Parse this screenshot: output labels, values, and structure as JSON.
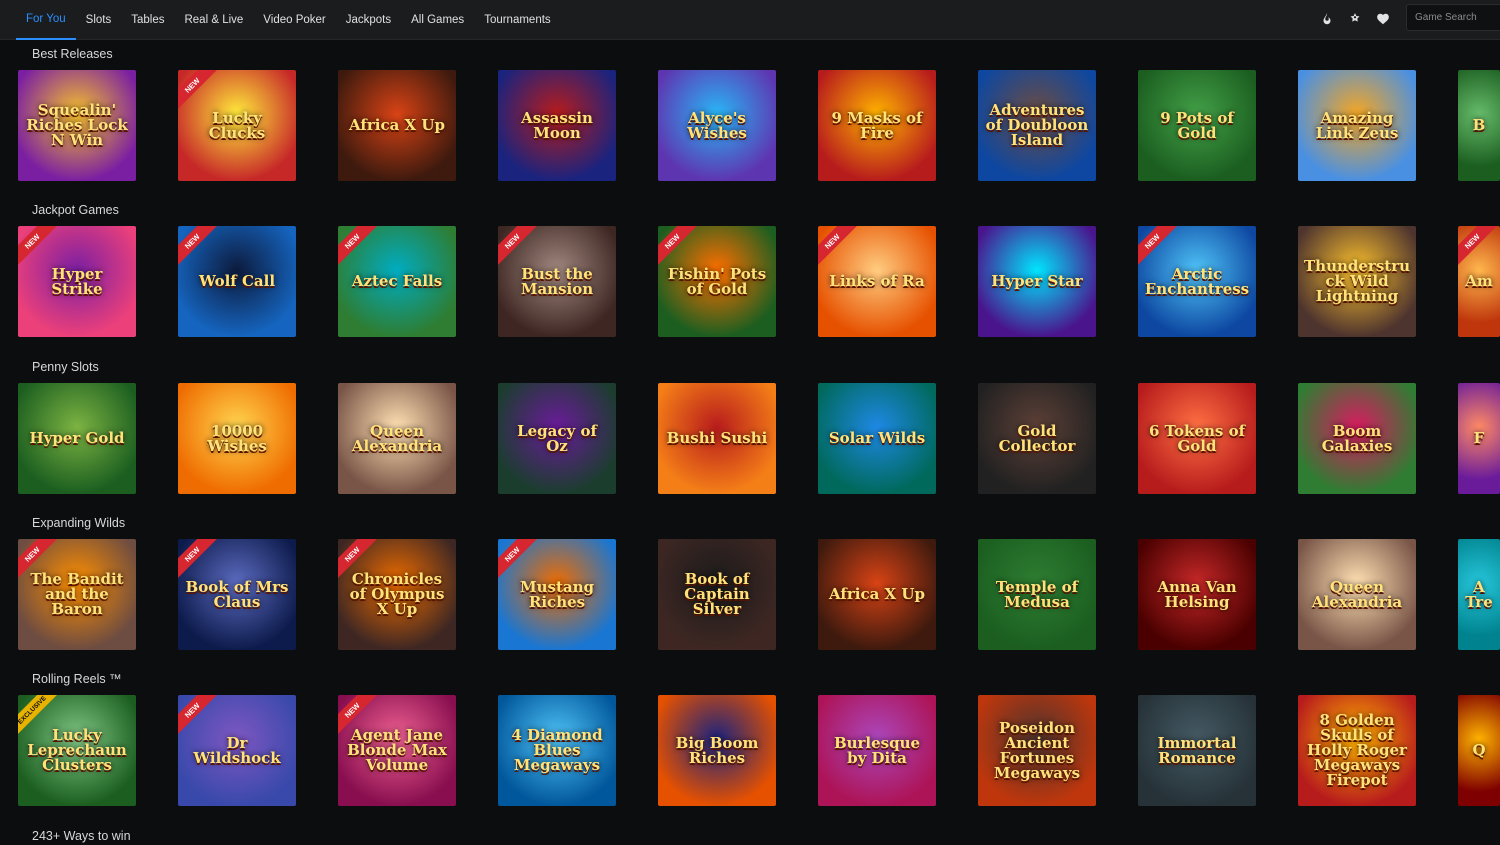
{
  "nav": {
    "items": [
      "For You",
      "Slots",
      "Tables",
      "Real & Live",
      "Video Poker",
      "Jackpots",
      "All Games",
      "Tournaments"
    ],
    "active_index": 0
  },
  "header_icons": [
    "flame-icon",
    "star-gear-icon",
    "heart-icon"
  ],
  "search": {
    "placeholder": "Game Search"
  },
  "sections": [
    {
      "title": "Best Releases",
      "games": [
        {
          "name": "Squealin' Riches Lock N Win",
          "badge": ""
        },
        {
          "name": "Lucky Clucks",
          "badge": "NEW"
        },
        {
          "name": "Africa X Up",
          "badge": ""
        },
        {
          "name": "Assassin Moon",
          "badge": ""
        },
        {
          "name": "Alyce's Wishes",
          "badge": ""
        },
        {
          "name": "9 Masks of Fire",
          "badge": ""
        },
        {
          "name": "Adventures of Doubloon Island",
          "badge": ""
        },
        {
          "name": "9 Pots of Gold",
          "badge": ""
        },
        {
          "name": "Amazing Link Zeus",
          "badge": ""
        },
        {
          "name": "B",
          "badge": ""
        }
      ]
    },
    {
      "title": "Jackpot Games",
      "games": [
        {
          "name": "Hyper Strike",
          "badge": "NEW"
        },
        {
          "name": "Wolf Call",
          "badge": "NEW"
        },
        {
          "name": "Aztec Falls",
          "badge": "NEW"
        },
        {
          "name": "Bust the Mansion",
          "badge": "NEW"
        },
        {
          "name": "Fishin' Pots of Gold",
          "badge": "NEW"
        },
        {
          "name": "Links of Ra",
          "badge": "NEW"
        },
        {
          "name": "Hyper Star",
          "badge": ""
        },
        {
          "name": "Arctic Enchantress",
          "badge": "NEW"
        },
        {
          "name": "Thunderstruck Wild Lightning",
          "badge": ""
        },
        {
          "name": "Am",
          "badge": "NEW"
        }
      ]
    },
    {
      "title": "Penny Slots",
      "games": [
        {
          "name": "Hyper Gold",
          "badge": ""
        },
        {
          "name": "10000 Wishes",
          "badge": ""
        },
        {
          "name": "Queen Alexandria",
          "badge": ""
        },
        {
          "name": "Legacy of Oz",
          "badge": ""
        },
        {
          "name": "Bushi Sushi",
          "badge": ""
        },
        {
          "name": "Solar Wilds",
          "badge": ""
        },
        {
          "name": "Gold Collector",
          "badge": ""
        },
        {
          "name": "6 Tokens of Gold",
          "badge": ""
        },
        {
          "name": "Boom Galaxies",
          "badge": ""
        },
        {
          "name": "F",
          "badge": ""
        }
      ]
    },
    {
      "title": "Expanding Wilds",
      "games": [
        {
          "name": "The Bandit and the Baron",
          "badge": "NEW"
        },
        {
          "name": "Book of Mrs Claus",
          "badge": "NEW"
        },
        {
          "name": "Chronicles of Olympus X Up",
          "badge": "NEW"
        },
        {
          "name": "Mustang Riches",
          "badge": "NEW"
        },
        {
          "name": "Book of Captain Silver",
          "badge": ""
        },
        {
          "name": "Africa X Up",
          "badge": ""
        },
        {
          "name": "Temple of Medusa",
          "badge": ""
        },
        {
          "name": "Anna Van Helsing",
          "badge": ""
        },
        {
          "name": "Queen Alexandria",
          "badge": ""
        },
        {
          "name": "A Tre",
          "badge": ""
        }
      ]
    },
    {
      "title": "Rolling Reels ™",
      "games": [
        {
          "name": "Lucky Leprechaun Clusters",
          "badge": "EXCLUSIVE"
        },
        {
          "name": "Dr Wildshock",
          "badge": "NEW"
        },
        {
          "name": "Agent Jane Blonde Max Volume",
          "badge": "NEW"
        },
        {
          "name": "4 Diamond Blues Megaways",
          "badge": ""
        },
        {
          "name": "Big Boom Riches",
          "badge": ""
        },
        {
          "name": "Burlesque by Dita",
          "badge": ""
        },
        {
          "name": "Poseidon Ancient Fortunes Megaways",
          "badge": ""
        },
        {
          "name": "Immortal Romance",
          "badge": ""
        },
        {
          "name": "8 Golden Skulls of Holly Roger Megaways Firepot",
          "badge": ""
        },
        {
          "name": "Q",
          "badge": ""
        }
      ]
    },
    {
      "title": "243+ Ways to win",
      "games": []
    }
  ],
  "colors": {
    "accent": "#2b8fff",
    "background": "#0c0d0f",
    "topbar": "#1b1c1e",
    "new_badge": "#d6262f",
    "exclusive_badge": "#e8b300"
  }
}
